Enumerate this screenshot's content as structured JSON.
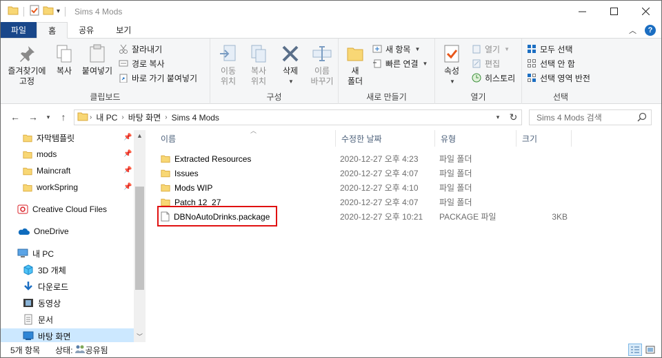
{
  "window": {
    "title": "Sims 4 Mods",
    "controls": {
      "minimize_icon": "minimize-icon",
      "maximize_icon": "maximize-icon",
      "close_icon": "close-icon"
    }
  },
  "ribbon_tabs": {
    "file": "파일",
    "home": "홈",
    "share": "공유",
    "view": "보기",
    "active": "홈"
  },
  "ribbon": {
    "clipboard": {
      "name": "클립보드",
      "pin": "즐겨찾기에 고정",
      "pin_l1": "즐겨찾기에",
      "pin_l2": "고정",
      "copy": "복사",
      "paste": "붙여넣기",
      "cut": "잘라내기",
      "copy_path": "경로 복사",
      "paste_shortcut": "바로 가기 붙여넣기"
    },
    "organize": {
      "name": "구성",
      "move_l1": "이동",
      "move_l2": "위치",
      "copyto_l1": "복사",
      "copyto_l2": "위치",
      "delete": "삭제",
      "rename_l1": "이름",
      "rename_l2": "바꾸기"
    },
    "new": {
      "name": "새로 만들기",
      "folder_l1": "새",
      "folder_l2": "폴더",
      "new_item": "새 항목",
      "easy_access": "빠른 연결"
    },
    "open": {
      "name": "열기",
      "properties": "속성",
      "open": "열기",
      "edit": "편집",
      "history": "히스토리"
    },
    "select": {
      "name": "선택",
      "select_all": "모두 선택",
      "select_none": "선택 안 함",
      "invert": "선택 영역 반전"
    }
  },
  "address": {
    "crumbs": [
      "내 PC",
      "바탕 화면",
      "Sims 4 Mods"
    ],
    "search_placeholder": "Sims 4 Mods 검색"
  },
  "navpane": {
    "quick": [
      {
        "label": "자막템플릿",
        "pinned": true
      },
      {
        "label": "mods",
        "pinned": true
      },
      {
        "label": "Maincraft",
        "pinned": true
      },
      {
        "label": "workSpring",
        "pinned": true
      }
    ],
    "creative_cloud": "Creative Cloud Files",
    "onedrive": "OneDrive",
    "this_pc": "내 PC",
    "pc_items": [
      "3D 개체",
      "다운로드",
      "동영상",
      "문서",
      "바탕 화면"
    ],
    "selected": "바탕 화면"
  },
  "columns": {
    "name": "이름",
    "modified": "수정한 날짜",
    "type": "유형",
    "size": "크기"
  },
  "files": [
    {
      "name": "Extracted Resources",
      "modified": "2020-12-27 오후 4:23",
      "type": "파일 폴더",
      "size": "",
      "kind": "folder"
    },
    {
      "name": "Issues",
      "modified": "2020-12-27 오후 4:07",
      "type": "파일 폴더",
      "size": "",
      "kind": "folder"
    },
    {
      "name": "Mods WIP",
      "modified": "2020-12-27 오후 4:10",
      "type": "파일 폴더",
      "size": "",
      "kind": "folder"
    },
    {
      "name": "Patch 12_27",
      "modified": "2020-12-27 오후 4:07",
      "type": "파일 폴더",
      "size": "",
      "kind": "folder"
    },
    {
      "name": "DBNoAutoDrinks.package",
      "modified": "2020-12-27 오후 10:21",
      "type": "PACKAGE 파일",
      "size": "3KB",
      "kind": "file",
      "highlighted": true
    }
  ],
  "status": {
    "count": "5개 항목",
    "state_label": "상태:",
    "state_value": "공유됨"
  },
  "colors": {
    "file_tab": "#19478a",
    "folder": "#f8d775",
    "highlight_box": "#e01010",
    "nav_selected": "#cce8ff"
  }
}
